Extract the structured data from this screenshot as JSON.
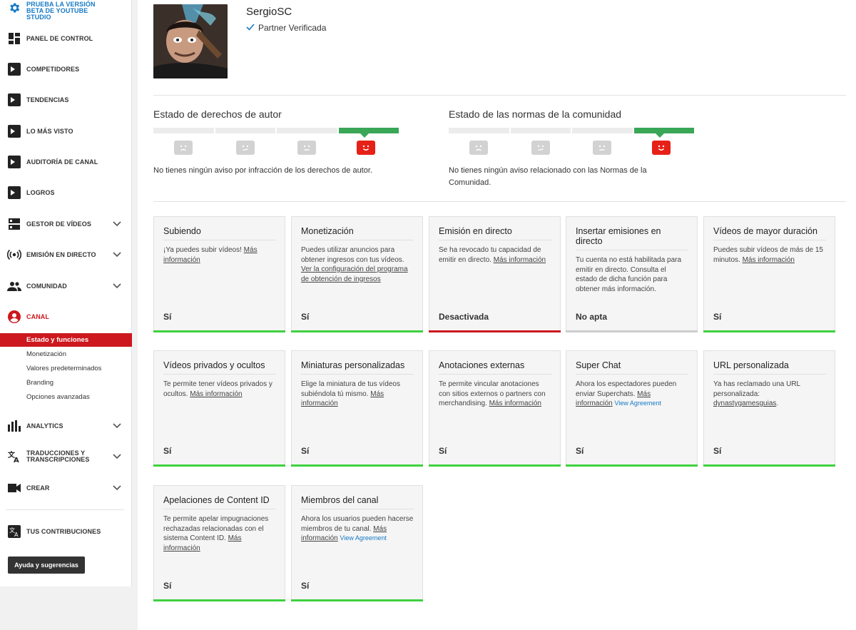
{
  "sidebar": {
    "beta": "PRUEBA LA VERSIÓN BETA DE YOUTUBE STUDIO",
    "items": [
      {
        "label": "PANEL DE CONTROL",
        "icon": "dashboard-icon"
      },
      {
        "label": "COMPETIDORES",
        "icon": "tubebuddy-icon"
      },
      {
        "label": "TENDENCIAS",
        "icon": "tubebuddy-icon"
      },
      {
        "label": "LO MÁS VISTO",
        "icon": "tubebuddy-icon"
      },
      {
        "label": "AUDITORÍA DE CANAL",
        "icon": "tubebuddy-icon"
      },
      {
        "label": "LOGROS",
        "icon": "tubebuddy-icon"
      },
      {
        "label": "GESTOR DE VÍDEOS",
        "icon": "video-manager-icon"
      },
      {
        "label": "EMISIÓN EN DIRECTO",
        "icon": "live-icon"
      },
      {
        "label": "COMUNIDAD",
        "icon": "community-icon"
      },
      {
        "label": "CANAL",
        "icon": "channel-icon"
      }
    ],
    "subitems": [
      "Estado y funciones",
      "Monetización",
      "Valores predeterminados",
      "Branding",
      "Opciones avanzadas"
    ],
    "items2": [
      {
        "label": "ANALYTICS",
        "icon": "analytics-icon"
      },
      {
        "label": "TRADUCCIONES Y TRANSCRIPCIONES",
        "icon": "translate-icon"
      },
      {
        "label": "CREAR",
        "icon": "create-icon"
      }
    ],
    "contrib": "TUS CONTRIBUCIONES",
    "help": "Ayuda y sugerencias",
    "accent": "#cc181e"
  },
  "channel": {
    "name": "SergioSC",
    "badge": "Partner Verificada"
  },
  "copyright": {
    "title": "Estado de derechos de autor",
    "text": "No tienes ningún aviso por infracción de los derechos de autor.",
    "level": 4,
    "of": 4
  },
  "community": {
    "title": "Estado de las normas de la comunidad",
    "text": "No tienes ningún aviso relacionado con las Normas de la Comunidad.",
    "level": 4,
    "of": 4
  },
  "features": [
    {
      "title": "Subiendo",
      "desc": "¡Ya puedes subir vídeos!",
      "link": "Más información",
      "status": "Sí",
      "state": "ok"
    },
    {
      "title": "Monetización",
      "desc": "Puedes utilizar anuncios para obtener ingresos con tus vídeos.",
      "link": "Ver la configuración del programa de obtención de ingresos",
      "status": "Sí",
      "state": "ok"
    },
    {
      "title": "Emisión en directo",
      "desc": "Se ha revocado tu capacidad de emitir en directo.",
      "link": "Más información",
      "status": "Desactivada",
      "state": "off"
    },
    {
      "title": "Insertar emisiones en directo",
      "desc": "Tu cuenta no está habilitada para emitir en directo. Consulta el estado de dicha función para obtener más información.",
      "link": "",
      "status": "No apta",
      "state": "na"
    },
    {
      "title": "Vídeos de mayor duración",
      "desc": "Puedes subir vídeos de más de 15 minutos.",
      "link": "Más información",
      "status": "Sí",
      "state": "ok"
    },
    {
      "title": "Vídeos privados y ocultos",
      "desc": "Te permite tener vídeos privados y ocultos.",
      "link": "Más información",
      "status": "Sí",
      "state": "ok"
    },
    {
      "title": "Miniaturas personalizadas",
      "desc": "Elige la miniatura de tus vídeos subiéndola tú mismo.",
      "link": "Más información",
      "status": "Sí",
      "state": "ok"
    },
    {
      "title": "Anotaciones externas",
      "desc": "Te permite vincular anotaciones con sitios externos o partners con merchandising.",
      "link": "Más información",
      "status": "Sí",
      "state": "ok"
    },
    {
      "title": "Super Chat",
      "desc": "Ahora los espectadores pueden enviar Superchats.",
      "link": "Más información",
      "extra": "View Agreement",
      "status": "Sí",
      "state": "ok"
    },
    {
      "title": "URL personalizada",
      "desc": "Ya has reclamado una URL personalizada:",
      "link": "dynastygamesguias",
      "suffix": ".",
      "status": "Sí",
      "state": "ok"
    },
    {
      "title": "Apelaciones de Content ID",
      "desc": "Te permite apelar impugnaciones rechazadas relacionadas con el sistema Content ID.",
      "link": "Más información",
      "status": "Sí",
      "state": "ok"
    },
    {
      "title": "Miembros del canal",
      "desc": "Ahora los usuarios pueden hacerse miembros de tu canal.",
      "link": "Más información",
      "extra": "View Agreement",
      "status": "Sí",
      "state": "ok"
    }
  ]
}
